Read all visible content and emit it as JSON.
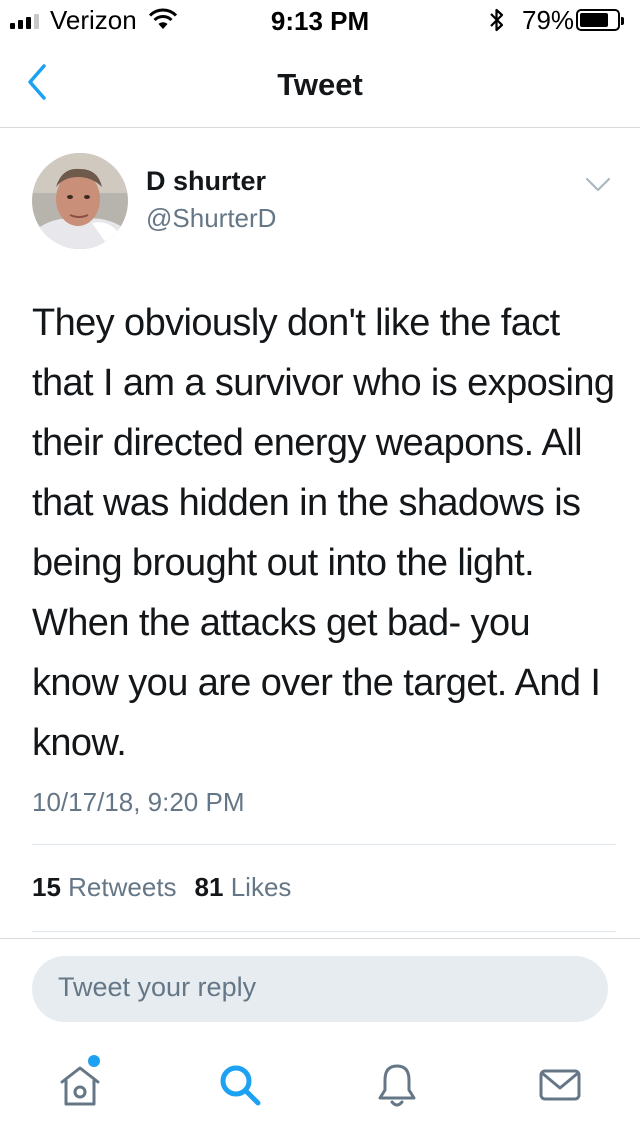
{
  "status_bar": {
    "carrier": "Verizon",
    "time": "9:13 PM",
    "battery_percent": "79%",
    "battery_level": 0.79,
    "signal_bars": 3
  },
  "nav": {
    "title": "Tweet",
    "back_icon": "chevron-left-icon"
  },
  "tweet": {
    "display_name": "D shurter",
    "handle": "@ShurterD",
    "text": "They obviously don't like the fact that I am a survivor who is exposing their directed energy weapons. All that was hidden in the shadows is being brought out into the light. When the attacks get bad- you know you are over the target. And I know.",
    "timestamp": "10/17/18, 9:20 PM",
    "retweet_count": "15",
    "retweet_label": "Retweets",
    "like_count": "81",
    "like_label": "Likes"
  },
  "reply": {
    "placeholder": "Tweet your reply"
  },
  "tab_bar": {
    "items": [
      "home-icon",
      "search-icon",
      "notifications-icon",
      "messages-icon"
    ],
    "accent": "#1da1f2"
  },
  "colors": {
    "accent": "#1da1f2",
    "secondary_text": "#657786",
    "primary_text": "#14171a"
  }
}
